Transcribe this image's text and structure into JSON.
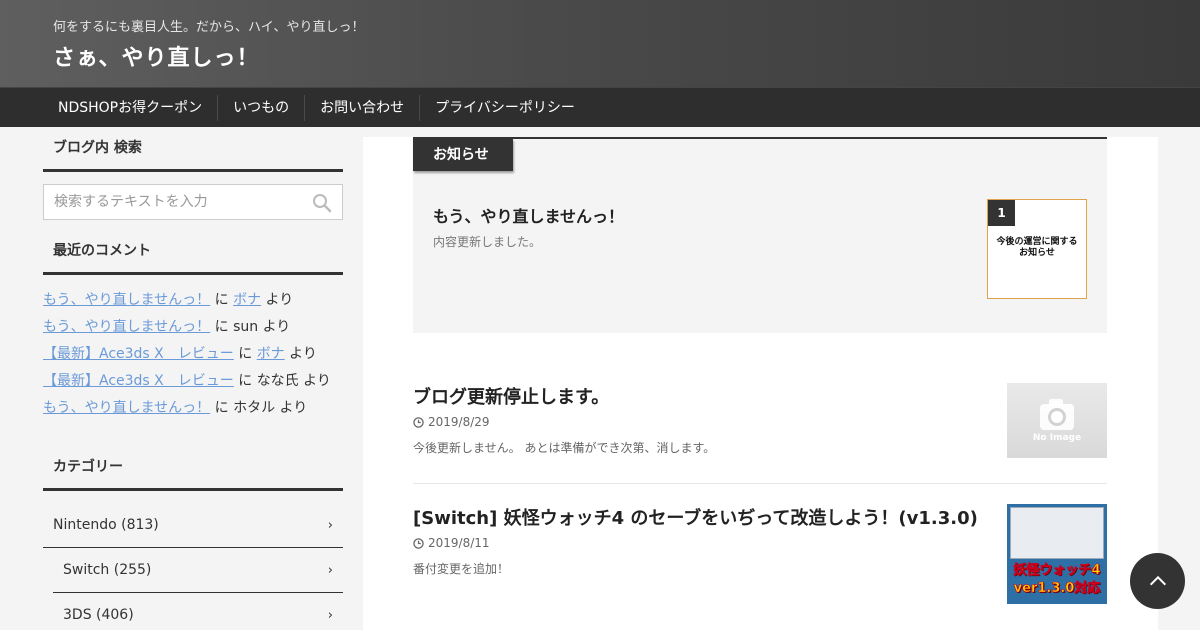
{
  "header": {
    "tagline": "何をするにも裏目人生。だから、ハイ、やり直しっ！",
    "title": "さぁ、やり直しっ！"
  },
  "nav": {
    "items": [
      "NDSHOPお得クーポン",
      "いつもの",
      "お問い合わせ",
      "プライバシーポリシー"
    ]
  },
  "sidebar": {
    "search": {
      "title": "ブログ内 検索",
      "placeholder": "検索するテキストを入力"
    },
    "recent_comments": {
      "title": "最近のコメント",
      "items": [
        {
          "post": "もう、やり直しませんっ！",
          "joiner": "に",
          "author": "ボナ",
          "author_linked": true,
          "suffix": "より"
        },
        {
          "post": "もう、やり直しませんっ！",
          "joiner": "に",
          "author": "sun",
          "author_linked": false,
          "suffix": "より"
        },
        {
          "post": "【最新】Ace3ds X　レビュー",
          "joiner": "に",
          "author": "ボナ",
          "author_linked": true,
          "suffix": "より"
        },
        {
          "post": "【最新】Ace3ds X　レビュー",
          "joiner": "に",
          "author": "なな氏",
          "author_linked": false,
          "suffix": "より"
        },
        {
          "post": "もう、やり直しませんっ！",
          "joiner": "に",
          "author": "ホタル",
          "author_linked": false,
          "suffix": "より"
        }
      ]
    },
    "categories": {
      "title": "カテゴリー",
      "items": [
        {
          "label": "Nintendo (813)",
          "sub": false
        },
        {
          "label": "Switch (255)",
          "sub": true
        },
        {
          "label": "3DS (406)",
          "sub": true
        }
      ]
    }
  },
  "notice": {
    "label": "お知らせ",
    "title": "もう、やり直しませんっ！",
    "desc": "内容更新しました。",
    "rank": "1",
    "thumb_text": "今後の運営に関する\nお知らせ"
  },
  "posts": [
    {
      "title": "ブログ更新停止します。",
      "date": "2019/8/29",
      "excerpt": "今後更新しません。 あとは準備ができ次第、消します。",
      "thumb_label": "No Image"
    },
    {
      "title": "[Switch] 妖怪ウォッチ4 のセーブをいぢって改造しよう！(v1.3.0)",
      "date": "2019/8/11",
      "excerpt": "番付変更を追加！",
      "thumb_line1": "妖怪ウォッチ4",
      "thumb_line2": "ver1.3.0対応"
    }
  ],
  "colors": {
    "link": "#6b9ad8",
    "dark": "#333333",
    "notice_border": "#e0a34c"
  }
}
